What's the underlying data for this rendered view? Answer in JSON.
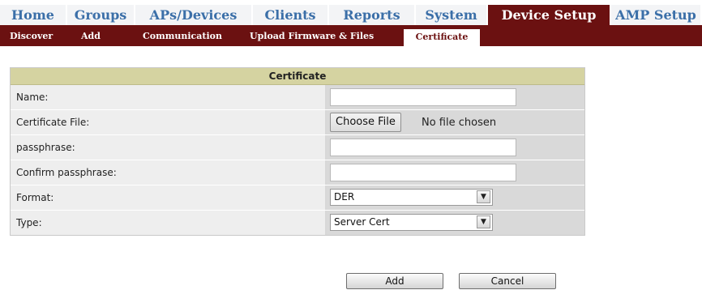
{
  "nav": {
    "tabs": [
      {
        "label": "Home"
      },
      {
        "label": "Groups"
      },
      {
        "label": "APs/Devices"
      },
      {
        "label": "Clients"
      },
      {
        "label": "Reports"
      },
      {
        "label": "System"
      },
      {
        "label": "Device Setup"
      },
      {
        "label": "AMP Setup"
      }
    ],
    "active": "Device Setup"
  },
  "subnav": {
    "items": [
      {
        "label": "Discover"
      },
      {
        "label": "Add"
      },
      {
        "label": "Communication"
      },
      {
        "label": "Upload Firmware & Files"
      },
      {
        "label": "Certificate"
      }
    ],
    "active": "Certificate"
  },
  "form": {
    "header": "Certificate",
    "fields": {
      "name": {
        "label": "Name:",
        "value": ""
      },
      "certificate_file": {
        "label": "Certificate File:",
        "button": "Choose File",
        "status": "No file chosen"
      },
      "passphrase": {
        "label": "passphrase:",
        "value": ""
      },
      "confirm_passphrase": {
        "label": "Confirm passphrase:",
        "value": ""
      },
      "format": {
        "label": "Format:",
        "selected": "DER"
      },
      "type": {
        "label": "Type:",
        "selected": "Server Cert"
      }
    }
  },
  "actions": {
    "add": "Add",
    "cancel": "Cancel"
  },
  "colors": {
    "nav_active_bg": "#6b1111",
    "nav_text": "#3b6fa8",
    "form_header_bg": "#d5d3a1"
  }
}
